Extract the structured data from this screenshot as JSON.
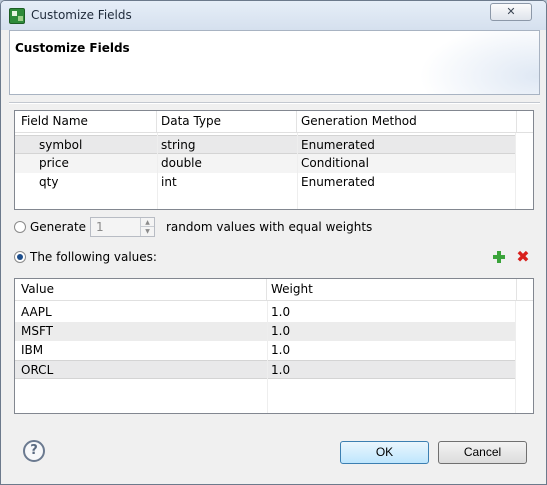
{
  "window": {
    "title": "Customize Fields",
    "close_glyph": "✕"
  },
  "header": {
    "title": "Customize Fields"
  },
  "fields_table": {
    "columns": [
      "Field Name",
      "Data Type",
      "Generation Method"
    ],
    "rows": [
      {
        "name": "symbol",
        "type": "string",
        "method": "Enumerated"
      },
      {
        "name": "price",
        "type": "double",
        "method": "Conditional"
      },
      {
        "name": "qty",
        "type": "int",
        "method": "Enumerated"
      }
    ]
  },
  "generate": {
    "label": "Generate",
    "count": "1",
    "suffix": "random values with equal weights",
    "selected": false
  },
  "following": {
    "label": "The following values:",
    "selected": true
  },
  "values_table": {
    "columns": [
      "Value",
      "Weight"
    ],
    "rows": [
      {
        "value": "AAPL",
        "weight": "1.0"
      },
      {
        "value": "MSFT",
        "weight": "1.0"
      },
      {
        "value": "IBM",
        "weight": "1.0"
      },
      {
        "value": "ORCL",
        "weight": "1.0"
      }
    ]
  },
  "icons": {
    "add": "add-icon",
    "delete": "delete-icon",
    "help": "help-icon"
  },
  "help": {
    "glyph": "?"
  },
  "buttons": {
    "ok": "OK",
    "cancel": "Cancel"
  }
}
